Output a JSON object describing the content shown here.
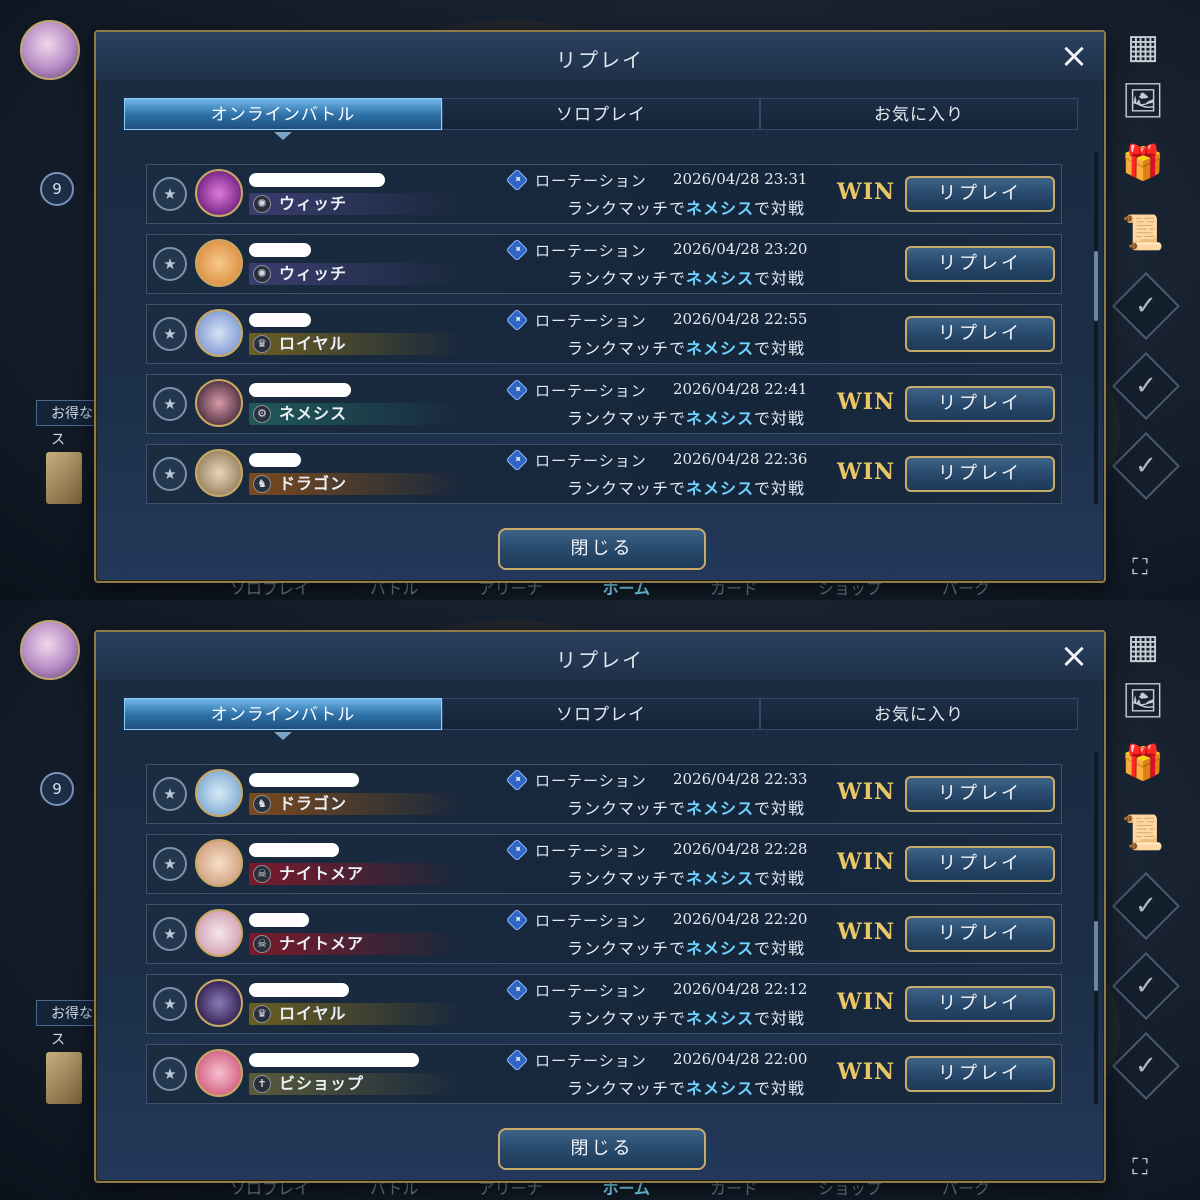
{
  "colors": {
    "accent": "#6fd2ff",
    "win": "#e9c767",
    "gold_border": "#c9ab69",
    "witch": "#3a3d6e",
    "royal": "#6b5e22",
    "nemesis": "#1f5a5a",
    "dragon": "#7a4a1c",
    "nightmare": "#7a1a2a",
    "bishop": "#5a5a3a"
  },
  "left_rail": {
    "level": "9",
    "promo_text": "お得なクリス"
  },
  "right_rail_icons": [
    "grid-icon",
    "image-edit-icon",
    "gift-icon",
    "scroll-icon",
    "check-icon",
    "check-icon",
    "check-icon",
    "expand-icon"
  ],
  "bottom_nav": [
    "ソロプレイ",
    "バトル",
    "アリーナ",
    "ホーム",
    "カード",
    "ショップ",
    "パーク"
  ],
  "screens": [
    {
      "dialog": {
        "title": "リプレイ",
        "close_icon": "×",
        "tabs": [
          "オンラインバトル",
          "ソロプレイ",
          "お気に入り"
        ],
        "active_tab": 0,
        "close_button": "閉じる",
        "scroll_position": 0.35
      },
      "rows": [
        {
          "class": "ウィッチ",
          "class_key": "witch",
          "format": "ローテーション",
          "datetime": "2026/04/28 23:31",
          "match_prefix": "ランクマッチで",
          "my_class": "ネメシス",
          "match_suffix": "で対戦",
          "result": "WIN",
          "button": "リプレイ"
        },
        {
          "class": "ウィッチ",
          "class_key": "witch",
          "format": "ローテーション",
          "datetime": "2026/04/28 23:20",
          "match_prefix": "ランクマッチで",
          "my_class": "ネメシス",
          "match_suffix": "で対戦",
          "result": "",
          "button": "リプレイ"
        },
        {
          "class": "ロイヤル",
          "class_key": "royal",
          "format": "ローテーション",
          "datetime": "2026/04/28 22:55",
          "match_prefix": "ランクマッチで",
          "my_class": "ネメシス",
          "match_suffix": "で対戦",
          "result": "",
          "button": "リプレイ"
        },
        {
          "class": "ネメシス",
          "class_key": "nemesis",
          "format": "ローテーション",
          "datetime": "2026/04/28 22:41",
          "match_prefix": "ランクマッチで",
          "my_class": "ネメシス",
          "match_suffix": "で対戦",
          "result": "WIN",
          "button": "リプレイ"
        },
        {
          "class": "ドラゴン",
          "class_key": "dragon",
          "format": "ローテーション",
          "datetime": "2026/04/28 22:36",
          "match_prefix": "ランクマッチで",
          "my_class": "ネメシス",
          "match_suffix": "で対戦",
          "result": "WIN",
          "button": "リプレイ"
        }
      ]
    },
    {
      "dialog": {
        "title": "リプレイ",
        "close_icon": "×",
        "tabs": [
          "オンラインバトル",
          "ソロプレイ",
          "お気に入り"
        ],
        "active_tab": 0,
        "close_button": "閉じる",
        "scroll_position": 0.6
      },
      "rows": [
        {
          "class": "ドラゴン",
          "class_key": "dragon",
          "format": "ローテーション",
          "datetime": "2026/04/28 22:33",
          "match_prefix": "ランクマッチで",
          "my_class": "ネメシス",
          "match_suffix": "で対戦",
          "result": "WIN",
          "button": "リプレイ"
        },
        {
          "class": "ナイトメア",
          "class_key": "nightmare",
          "format": "ローテーション",
          "datetime": "2026/04/28 22:28",
          "match_prefix": "ランクマッチで",
          "my_class": "ネメシス",
          "match_suffix": "で対戦",
          "result": "WIN",
          "button": "リプレイ"
        },
        {
          "class": "ナイトメア",
          "class_key": "nightmare",
          "format": "ローテーション",
          "datetime": "2026/04/28 22:20",
          "match_prefix": "ランクマッチで",
          "my_class": "ネメシス",
          "match_suffix": "で対戦",
          "result": "WIN",
          "button": "リプレイ"
        },
        {
          "class": "ロイヤル",
          "class_key": "royal",
          "format": "ローテーション",
          "datetime": "2026/04/28 22:12",
          "match_prefix": "ランクマッチで",
          "my_class": "ネメシス",
          "match_suffix": "で対戦",
          "result": "WIN",
          "button": "リプレイ"
        },
        {
          "class": "ビショップ",
          "class_key": "bishop",
          "format": "ローテーション",
          "datetime": "2026/04/28 22:00",
          "match_prefix": "ランクマッチで",
          "my_class": "ネメシス",
          "match_suffix": "で対戦",
          "result": "WIN",
          "button": "リプレイ"
        }
      ]
    }
  ]
}
